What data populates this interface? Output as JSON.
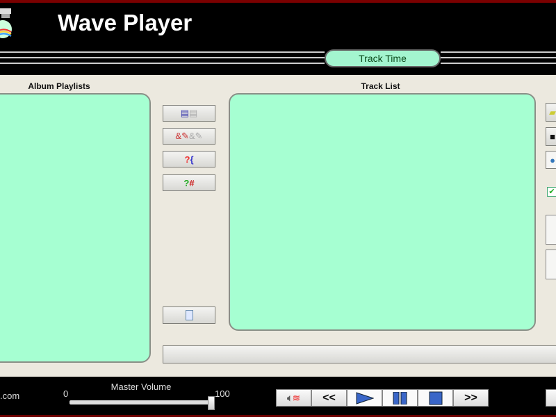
{
  "header": {
    "title": "Wave Player",
    "track_time_label": "Track Time"
  },
  "playlists": {
    "label": "Album Playlists"
  },
  "tracklist": {
    "label": "Track List"
  },
  "footer": {
    "site_suffix": ".com",
    "volume_label": "Master Volume",
    "volume_min": "0",
    "volume_max": "100",
    "volume_value": 100
  },
  "transport": {
    "rewind": "<<",
    "forward": ">>"
  },
  "options": {
    "checkbox_checked": true
  },
  "colors": {
    "panel": "#a6ffd2",
    "accent_red": "#7a0000"
  }
}
